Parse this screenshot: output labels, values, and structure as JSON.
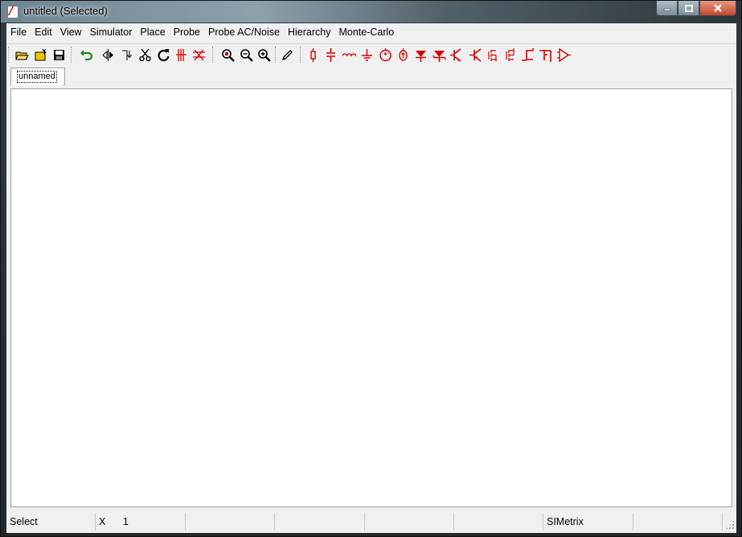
{
  "window": {
    "title": "untitled (Selected)",
    "app_icon": "simetrix-logo-icon",
    "controls": [
      "minimize-icon",
      "maximize-icon",
      "close-icon"
    ]
  },
  "menubar": {
    "items": [
      "File",
      "Edit",
      "View",
      "Simulator",
      "Place",
      "Probe",
      "Probe AC/Noise",
      "Hierarchy",
      "Monte-Carlo"
    ]
  },
  "toolbar": {
    "colors": {
      "black": "#000000",
      "red": "#d40000",
      "green": "#1a8a1a",
      "yellow": "#f2c200"
    },
    "groups": [
      [
        "open-folder-icon",
        "new-file-icon",
        "save-icon"
      ],
      [
        "undo-icon",
        "flip-horizontal-icon",
        "flip-vertical-icon",
        "cut-icon",
        "rotate-icon",
        "bus-icon",
        "wire-delete-icon"
      ],
      [
        "zoom-full-icon",
        "zoom-out-icon",
        "zoom-in-icon"
      ],
      [
        "pencil-icon"
      ],
      [
        "resistor-icon",
        "capacitor-icon",
        "inductor-icon",
        "ground-icon",
        "voltage-source-icon",
        "current-source-icon",
        "diode-icon",
        "zener-diode-icon",
        "npn-transistor-icon",
        "pnp-transistor-icon",
        "nmos-icon",
        "pmos-icon",
        "njfet-icon",
        "pjfet-icon",
        "opamp-icon"
      ]
    ]
  },
  "tabs": [
    {
      "label": "unnamed",
      "active": true
    }
  ],
  "statusbar": {
    "mode": "Select",
    "x_label": "X",
    "x_value": "1",
    "c3": "",
    "c4": "",
    "c5": "",
    "c6": "",
    "app": "SIMetrix",
    "c8": ""
  }
}
